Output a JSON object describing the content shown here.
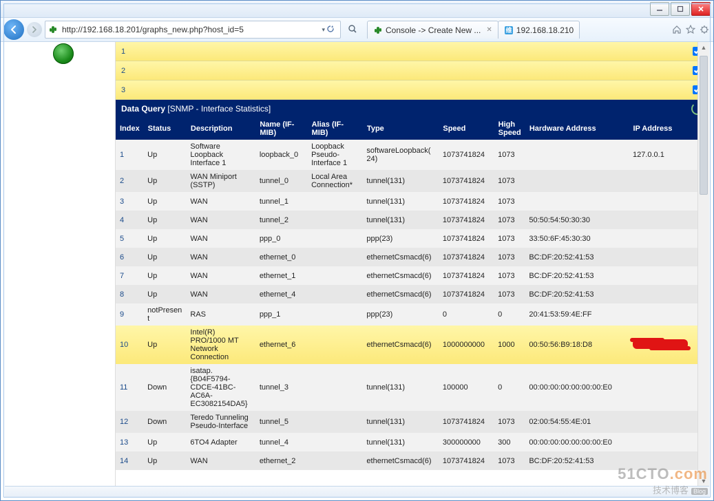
{
  "browser": {
    "url": "http://192.168.18.201/graphs_new.php?host_id=5",
    "tabs": [
      {
        "label": "Console -> Create New ..."
      },
      {
        "label": "192.168.18.210"
      }
    ]
  },
  "yellow_rows": [
    {
      "num": "1",
      "checked": true
    },
    {
      "num": "2",
      "checked": true
    },
    {
      "num": "3",
      "checked": true
    }
  ],
  "data_query": {
    "title_bold": "Data Query",
    "title_rest": " [SNMP - Interface Statistics]",
    "columns": [
      "Index",
      "Status",
      "Description",
      "Name (IF-MIB)",
      "Alias (IF-MIB)",
      "Type",
      "Speed",
      "High Speed",
      "Hardware Address",
      "IP Address",
      ""
    ],
    "rows": [
      {
        "idx": "1",
        "status": "Up",
        "desc": "Software Loopback Interface 1",
        "name": "loopback_0",
        "alias": "Loopback Pseudo-Interface 1",
        "type": "softwareLoopback(24)",
        "speed": "1073741824",
        "hspeed": "1073",
        "hw": "",
        "ip": "127.0.0.1",
        "checked": false,
        "hl": false
      },
      {
        "idx": "2",
        "status": "Up",
        "desc": "WAN Miniport (SSTP)",
        "name": "tunnel_0",
        "alias": "Local Area Connection*",
        "type": "tunnel(131)",
        "speed": "1073741824",
        "hspeed": "1073",
        "hw": "",
        "ip": "",
        "checked": false,
        "hl": false
      },
      {
        "idx": "3",
        "status": "Up",
        "desc": "WAN",
        "name": "tunnel_1",
        "alias": "",
        "type": "tunnel(131)",
        "speed": "1073741824",
        "hspeed": "1073",
        "hw": "",
        "ip": "",
        "checked": false,
        "hl": false
      },
      {
        "idx": "4",
        "status": "Up",
        "desc": "WAN",
        "name": "tunnel_2",
        "alias": "",
        "type": "tunnel(131)",
        "speed": "1073741824",
        "hspeed": "1073",
        "hw": "50:50:54:50:30:30",
        "ip": "",
        "checked": false,
        "hl": false
      },
      {
        "idx": "5",
        "status": "Up",
        "desc": "WAN",
        "name": "ppp_0",
        "alias": "",
        "type": "ppp(23)",
        "speed": "1073741824",
        "hspeed": "1073",
        "hw": "33:50:6F:45:30:30",
        "ip": "",
        "checked": false,
        "hl": false
      },
      {
        "idx": "6",
        "status": "Up",
        "desc": "WAN",
        "name": "ethernet_0",
        "alias": "",
        "type": "ethernetCsmacd(6)",
        "speed": "1073741824",
        "hspeed": "1073",
        "hw": "BC:DF:20:52:41:53",
        "ip": "",
        "checked": false,
        "hl": false
      },
      {
        "idx": "7",
        "status": "Up",
        "desc": "WAN",
        "name": "ethernet_1",
        "alias": "",
        "type": "ethernetCsmacd(6)",
        "speed": "1073741824",
        "hspeed": "1073",
        "hw": "BC:DF:20:52:41:53",
        "ip": "",
        "checked": false,
        "hl": false
      },
      {
        "idx": "8",
        "status": "Up",
        "desc": "WAN",
        "name": "ethernet_4",
        "alias": "",
        "type": "ethernetCsmacd(6)",
        "speed": "1073741824",
        "hspeed": "1073",
        "hw": "BC:DF:20:52:41:53",
        "ip": "",
        "checked": false,
        "hl": false
      },
      {
        "idx": "9",
        "status": "notPresent",
        "desc": "RAS",
        "name": "ppp_1",
        "alias": "",
        "type": "ppp(23)",
        "speed": "0",
        "hspeed": "0",
        "hw": "20:41:53:59:4E:FF",
        "ip": "",
        "checked": false,
        "hl": false
      },
      {
        "idx": "10",
        "status": "Up",
        "desc": "Intel(R) PRO/1000 MT Network Connection",
        "name": "ethernet_6",
        "alias": "",
        "type": "ethernetCsmacd(6)",
        "speed": "1000000000",
        "hspeed": "1000",
        "hw": "00:50:56:B9:18:D8",
        "ip": "REDACTED",
        "checked": true,
        "hl": true
      },
      {
        "idx": "11",
        "status": "Down",
        "desc": "isatap.{B04F5794-CDCE-41BC-AC6A-EC3082154DA5}",
        "name": "tunnel_3",
        "alias": "",
        "type": "tunnel(131)",
        "speed": "100000",
        "hspeed": "0",
        "hw": "00:00:00:00:00:00:00:E0",
        "ip": "",
        "checked": false,
        "hl": false
      },
      {
        "idx": "12",
        "status": "Down",
        "desc": "Teredo Tunneling Pseudo-Interface",
        "name": "tunnel_5",
        "alias": "",
        "type": "tunnel(131)",
        "speed": "1073741824",
        "hspeed": "1073",
        "hw": "02:00:54:55:4E:01",
        "ip": "",
        "checked": false,
        "hl": false
      },
      {
        "idx": "13",
        "status": "Up",
        "desc": "6TO4 Adapter",
        "name": "tunnel_4",
        "alias": "",
        "type": "tunnel(131)",
        "speed": "300000000",
        "hspeed": "300",
        "hw": "00:00:00:00:00:00:00:E0",
        "ip": "",
        "checked": false,
        "hl": false
      },
      {
        "idx": "14",
        "status": "Up",
        "desc": "WAN",
        "name": "ethernet_2",
        "alias": "",
        "type": "ethernetCsmacd(6)",
        "speed": "1073741824",
        "hspeed": "1073",
        "hw": "BC:DF:20:52:41:53",
        "ip": "",
        "checked": false,
        "hl": false
      }
    ]
  },
  "watermark": {
    "line1_a": "51CTO",
    "line1_b": ".com",
    "line2": "技术博客",
    "blog": "Blog"
  }
}
